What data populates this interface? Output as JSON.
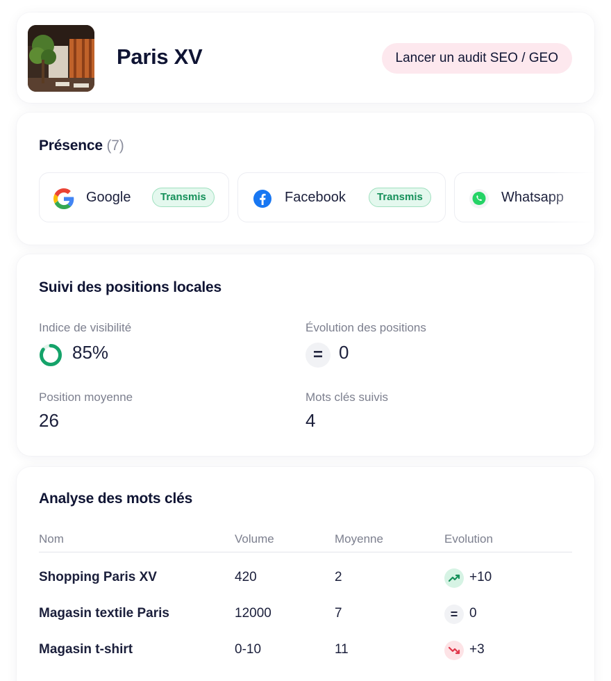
{
  "header": {
    "title": "Paris XV",
    "audit_button": "Lancer un audit SEO / GEO"
  },
  "presence": {
    "title": "Présence",
    "count": "(7)",
    "channels": [
      {
        "name": "Google",
        "status": "Transmis",
        "icon": "google-icon"
      },
      {
        "name": "Facebook",
        "status": "Transmis",
        "icon": "facebook-icon"
      },
      {
        "name": "Whatsapp",
        "icon": "whatsapp-icon"
      }
    ]
  },
  "positions": {
    "title": "Suivi des positions locales",
    "visibility_label": "Indice de visibilité",
    "visibility_value": "85%",
    "visibility_fraction": 0.85,
    "evolution_label": "Évolution des positions",
    "evolution_value": "0",
    "avg_label": "Position moyenne",
    "avg_value": "26",
    "keywords_label": "Mots clés suivis",
    "keywords_value": "4"
  },
  "keywords": {
    "title": "Analyse des mots clés",
    "columns": [
      "Nom",
      "Volume",
      "Moyenne",
      "Evolution"
    ],
    "rows": [
      {
        "name": "Shopping Paris XV",
        "volume": "420",
        "average": "2",
        "evolution": "+10",
        "trend": "up"
      },
      {
        "name": "Magasin textile Paris",
        "volume": "12000",
        "average": "7",
        "evolution": "0",
        "trend": "flat"
      },
      {
        "name": "Magasin t-shirt",
        "volume": "0-10",
        "average": "11",
        "evolution": "+3",
        "trend": "down"
      }
    ]
  },
  "colors": {
    "accent_green": "#15a36a",
    "badge_bg": "#e4f8ee",
    "audit_bg": "#fde8ee",
    "down_red": "#e0364a"
  }
}
